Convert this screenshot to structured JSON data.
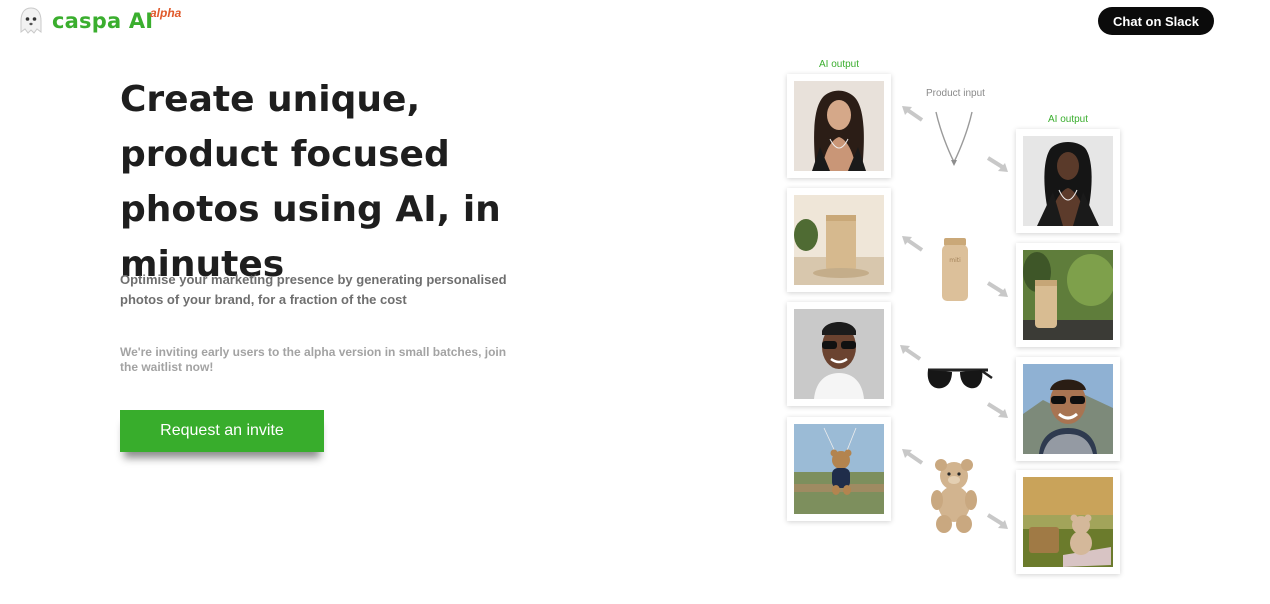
{
  "brand": {
    "name": "caspa AI",
    "badge": "alpha",
    "accent": "#3aae2e",
    "badge_color": "#e0592a"
  },
  "header": {
    "chat_button": "Chat on Slack"
  },
  "hero": {
    "title": "Create unique, product focused photos using AI, in minutes",
    "subtitle": "Optimise your marketing presence by generating personalised photos of your brand, for a fraction of the cost",
    "note": "We're inviting early users to the alpha version in small batches, join the waitlist now!",
    "cta": "Request an invite",
    "cta_color": "#38ad2c"
  },
  "gallery": {
    "ai_output_label_left": "AI output",
    "ai_output_label_right": "AI output",
    "product_input_label": "Product input",
    "rows": [
      {
        "product": "necklace",
        "left_image": "woman-with-necklace",
        "right_image": "woman-with-necklace-2"
      },
      {
        "product": "bottle",
        "left_image": "bottle-on-table",
        "right_image": "bottle-with-plants"
      },
      {
        "product": "sunglasses",
        "left_image": "man-with-sunglasses",
        "right_image": "man-with-sunglasses-outdoor"
      },
      {
        "product": "teddy-bear",
        "left_image": "teddy-bear-parachute",
        "right_image": "teddy-bear-picnic"
      }
    ]
  }
}
